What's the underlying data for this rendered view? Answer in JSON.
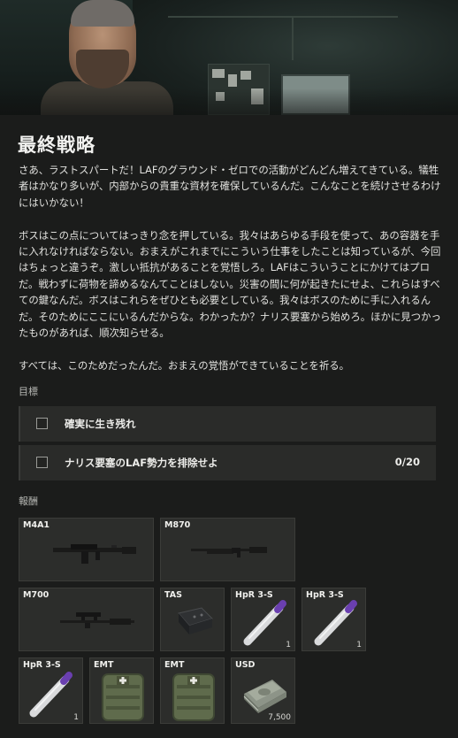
{
  "mission": {
    "title": "最終戦略",
    "paragraphs": [
      "さあ、ラストスパートだ！LAFのグラウンド・ゼロでの活動がどんどん増えてきている。犠牲者はかなり多いが、内部からの貴重な資材を確保しているんだ。こんなことを続けさせるわけにはいかない！",
      "ボスはこの点についてはっきり念を押している。我々はあらゆる手段を使って、あの容器を手に入れなければならない。おまえがこれまでにこういう仕事をしたことは知っているが、今回はちょっと違うぞ。激しい抵抗があることを覚悟しろ。LAFはこういうことにかけてはプロだ。戦わずに荷物を諦めるなんてことはしない。災害の間に何が起きたにせよ、これらはすべての鍵なんだ。ボスはこれらをぜひとも必要としている。我々はボスのために手に入れるんだ。そのためにここにいるんだからな。わかったか？ナリス要塞から始めろ。ほかに見つかったものがあれば、順次知らせる。",
      "すべては、このためだったんだ。おまえの覚悟ができていることを祈る。"
    ]
  },
  "objectives": {
    "label": "目標",
    "items": [
      {
        "text": "確実に生き残れ",
        "progress": ""
      },
      {
        "text": "ナリス要塞のLAF勢力を排除せよ",
        "progress": "0/20"
      }
    ]
  },
  "rewards": {
    "label": "報酬",
    "items": [
      {
        "name": "M4A1",
        "qty": "",
        "icon": "rifle-icon"
      },
      {
        "name": "M870",
        "qty": "",
        "icon": "shotgun-icon"
      },
      {
        "name": "M700",
        "qty": "",
        "icon": "sniper-rifle-icon"
      },
      {
        "name": "TAS",
        "qty": "",
        "icon": "armor-plate-icon"
      },
      {
        "name": "HpR 3-S",
        "qty": "1",
        "icon": "syringe-icon"
      },
      {
        "name": "HpR 3-S",
        "qty": "1",
        "icon": "syringe-icon"
      },
      {
        "name": "HpR 3-S",
        "qty": "1",
        "icon": "syringe-icon"
      },
      {
        "name": "EMT",
        "qty": "",
        "icon": "medkit-icon"
      },
      {
        "name": "EMT",
        "qty": "",
        "icon": "medkit-icon"
      },
      {
        "name": "USD",
        "qty": "7,500",
        "icon": "cash-icon"
      }
    ]
  }
}
